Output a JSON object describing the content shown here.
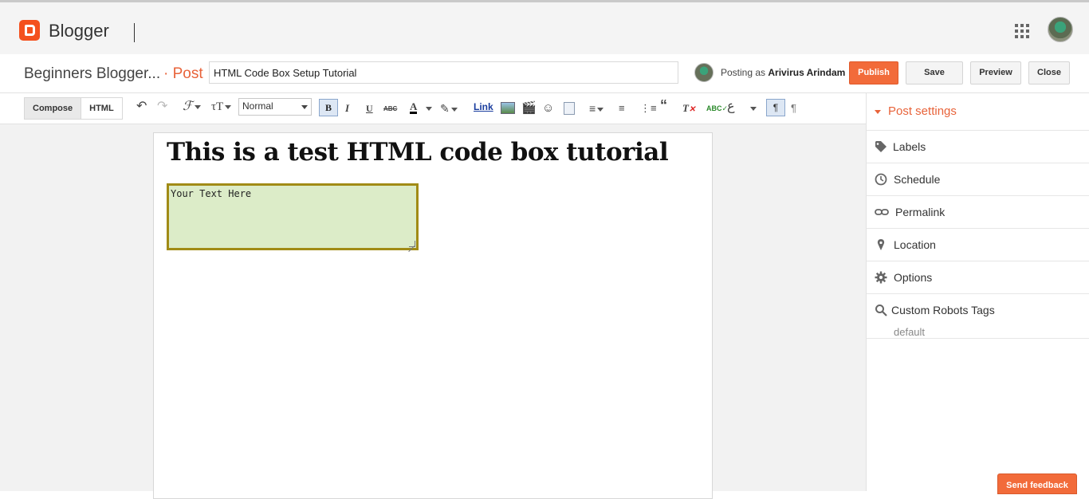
{
  "app": {
    "brand": "Blogger"
  },
  "header": {
    "blog_name": "Beginners Blogger...",
    "post_tag": "· Post",
    "title_value": "HTML Code Box Setup Tutorial",
    "posting_as_prefix": "Posting as",
    "posting_as_user": "Arivirus Arindam",
    "publish_label": "Publish",
    "save_label": "Save",
    "preview_label": "Preview",
    "close_label": "Close"
  },
  "toolbar": {
    "compose_label": "Compose",
    "html_label": "HTML",
    "format_value": "Normal",
    "bold": "B",
    "italic": "I",
    "underline": "U",
    "strike": "ABC",
    "link_label": "Link",
    "pilcrow": "¶",
    "icons": [
      "undo-icon",
      "redo-icon",
      "font-family-icon",
      "font-size-icon",
      "text-color-icon",
      "highlight-icon",
      "image-icon",
      "video-icon",
      "emoji-icon",
      "jump-break-icon",
      "align-icon",
      "numbered-list-icon",
      "bullet-list-icon",
      "quote-icon",
      "remove-format-icon",
      "spellcheck-icon",
      "input-tools-icon"
    ]
  },
  "document": {
    "heading": "This is a test HTML code box tutorial",
    "code_box_text": "Your Text Here"
  },
  "sidebar": {
    "header": "Post settings",
    "items": [
      {
        "label": "Labels",
        "icon": "tag-icon"
      },
      {
        "label": "Schedule",
        "icon": "clock-icon"
      },
      {
        "label": "Permalink",
        "icon": "link-icon"
      },
      {
        "label": "Location",
        "icon": "pin-icon"
      },
      {
        "label": "Options",
        "icon": "gear-icon"
      },
      {
        "label": "Custom Robots Tags",
        "icon": "search-icon"
      }
    ],
    "robots_value": "default"
  },
  "feedback_label": "Send feedback",
  "colors": {
    "accent": "#f26b3a",
    "codebox_bg": "#dcecc8",
    "codebox_border": "#a18b16"
  }
}
